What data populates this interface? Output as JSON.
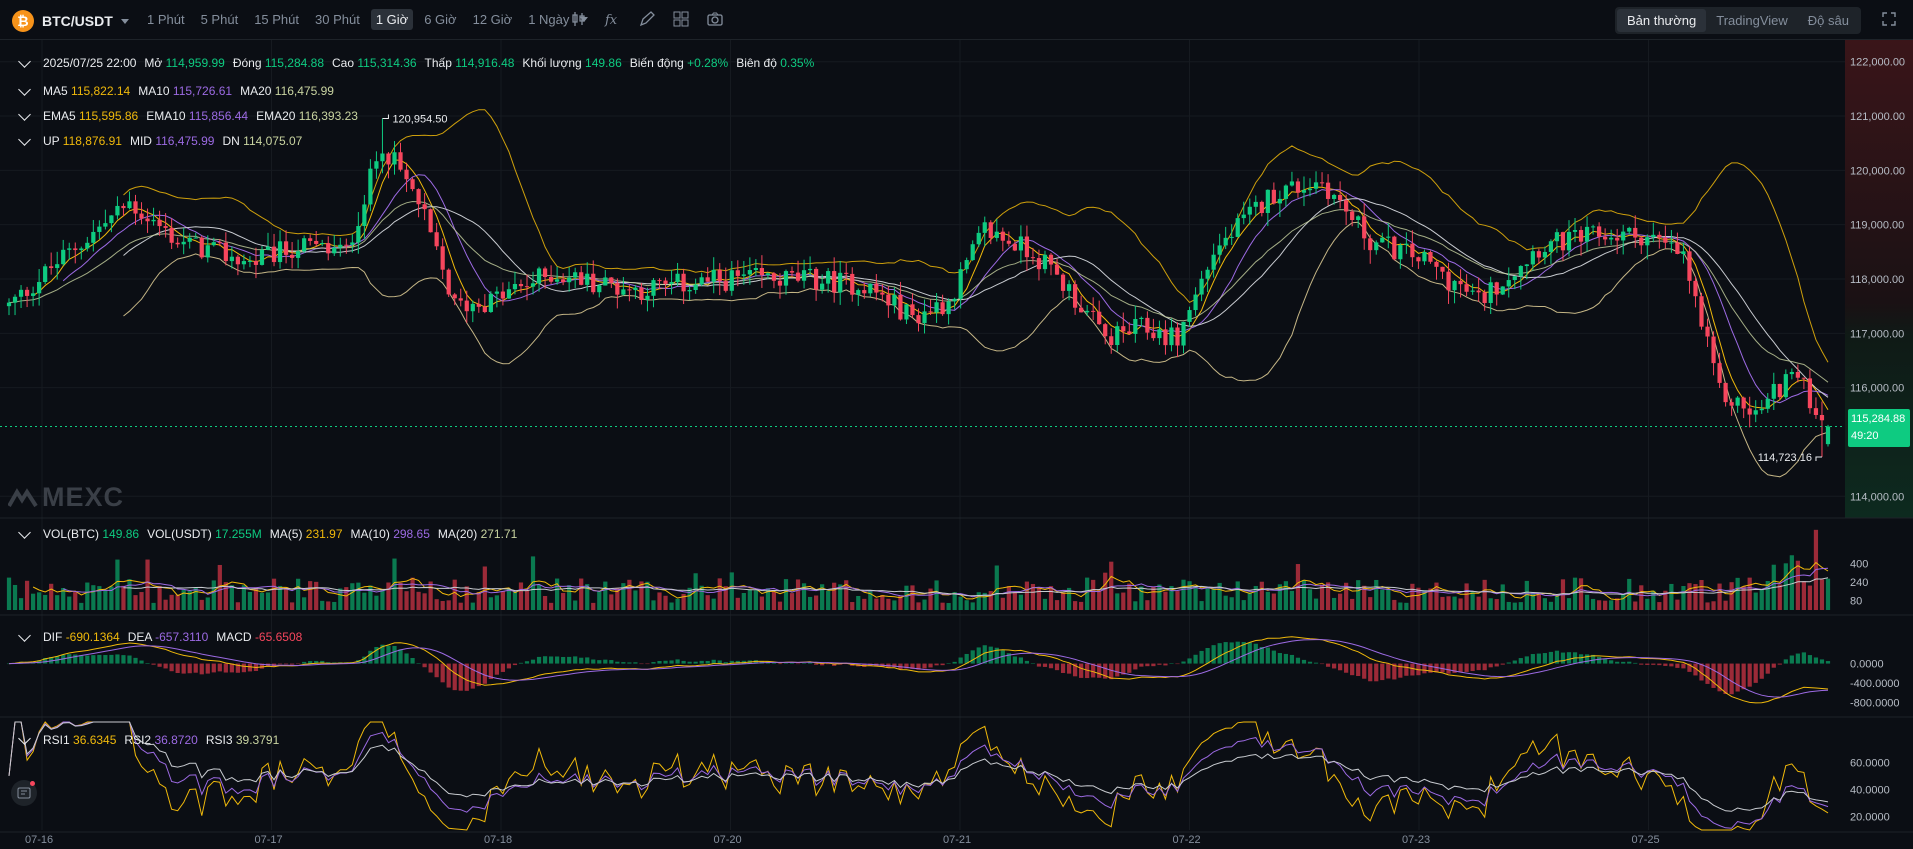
{
  "toolbar": {
    "pair": "BTC/USDT",
    "intervals": [
      "1 Phút",
      "5 Phút",
      "15 Phút",
      "30 Phút",
      "1 Giờ",
      "6 Giờ",
      "12 Giờ",
      "1 Ngày"
    ],
    "active_interval": "1 Giờ",
    "tools": [
      "candle-type-icon",
      "indicator-icon",
      "draw-icon",
      "layout-icon",
      "camera-icon"
    ],
    "views": [
      "Bản thường",
      "TradingView",
      "Độ sâu"
    ],
    "active_view": "Bản thường"
  },
  "colors": {
    "up": "#0ecb81",
    "down": "#f6465d",
    "ma5": "#f0b90b",
    "ma10": "#9c6ae3",
    "ma20": "#c8cbd0",
    "ema20": "#c9d4a1",
    "boll_up": "#f0b90b",
    "boll_mid": "#9c6ae3",
    "boll_dn": "#e6d39a"
  },
  "ohlc": {
    "date": "2025/07/25 22:00",
    "open_label": "Mở",
    "open": "114,959.99",
    "close_label": "Đóng",
    "close": "115,284.88",
    "high_label": "Cao",
    "high": "115,314.36",
    "low_label": "Thấp",
    "low": "114,916.48",
    "vol_label": "Khối lượng",
    "vol": "149.86",
    "chg_label": "Biến động",
    "chg": "+0.28%",
    "amp_label": "Biên độ",
    "amp": "0.35%"
  },
  "ma": {
    "ma5_label": "MA5",
    "ma5": "115,822.14",
    "ma10_label": "MA10",
    "ma10": "115,726.61",
    "ma20_label": "MA20",
    "ma20": "116,475.99"
  },
  "ema": {
    "ema5_label": "EMA5",
    "ema5": "115,595.86",
    "ema10_label": "EMA10",
    "ema10": "115,856.44",
    "ema20_label": "EMA20",
    "ema20": "116,393.23"
  },
  "boll": {
    "up_label": "UP",
    "up": "118,876.91",
    "mid_label": "MID",
    "mid": "116,475.99",
    "dn_label": "DN",
    "dn": "114,075.07"
  },
  "vol_legend": {
    "btc_label": "VOL(BTC)",
    "btc": "149.86",
    "usdt_label": "VOL(USDT)",
    "usdt": "17.255M",
    "ma5_label": "MA(5)",
    "ma5": "231.97",
    "ma10_label": "MA(10)",
    "ma10": "298.65",
    "ma20_label": "MA(20)",
    "ma20": "271.71"
  },
  "macd_legend": {
    "dif_label": "DIF",
    "dif": "-690.1364",
    "dea_label": "DEA",
    "dea": "-657.3110",
    "macd_label": "MACD",
    "macd": "-65.6508"
  },
  "rsi_legend": {
    "rsi1_label": "RSI1",
    "rsi1": "36.6345",
    "rsi2_label": "RSI2",
    "rsi2": "36.8720",
    "rsi3_label": "RSI3",
    "rsi3": "39.3791"
  },
  "last_price": {
    "price": "115,284.88",
    "countdown": "49:20"
  },
  "high_marker": "120,954.50",
  "low_marker": "114,723.16",
  "watermark": "MEXC",
  "chart_data": {
    "type": "candlestick",
    "interval": "1h",
    "price_axis": {
      "ticks": [
        "122,000.00",
        "121,000.00",
        "120,000.00",
        "119,000.00",
        "118,000.00",
        "117,000.00",
        "116,000.00",
        "114,000.00"
      ],
      "range": [
        113600,
        122400
      ]
    },
    "volume_axis": {
      "ticks": [
        "400",
        "240",
        "80"
      ],
      "max": 560
    },
    "macd_axis": {
      "ticks": [
        "0.0000",
        "-400.0000",
        "-800.0000"
      ],
      "range": [
        -1000,
        900
      ]
    },
    "rsi_axis": {
      "ticks": [
        "60.0000",
        "40.0000",
        "20.0000"
      ],
      "range": [
        10,
        90
      ]
    },
    "x_labels": [
      "07-16",
      "07-17",
      "07-18",
      "07-20",
      "07-21",
      "07-22",
      "07-23",
      "07-25"
    ],
    "anchors": [
      [
        0,
        117500
      ],
      [
        8,
        118300
      ],
      [
        20,
        119400
      ],
      [
        28,
        118700
      ],
      [
        40,
        118300
      ],
      [
        48,
        118600
      ],
      [
        56,
        118500
      ],
      [
        62,
        120500
      ],
      [
        68,
        119400
      ],
      [
        74,
        117500
      ],
      [
        80,
        117600
      ],
      [
        90,
        118100
      ],
      [
        104,
        117800
      ],
      [
        120,
        118000
      ],
      [
        132,
        118000
      ],
      [
        142,
        117900
      ],
      [
        150,
        117300
      ],
      [
        156,
        117600
      ],
      [
        162,
        118900
      ],
      [
        170,
        118500
      ],
      [
        176,
        117800
      ],
      [
        182,
        116900
      ],
      [
        188,
        117100
      ],
      [
        194,
        116900
      ],
      [
        200,
        118500
      ],
      [
        210,
        119600
      ],
      [
        218,
        119800
      ],
      [
        226,
        118700
      ],
      [
        234,
        118400
      ],
      [
        244,
        117600
      ],
      [
        254,
        118600
      ],
      [
        264,
        118800
      ],
      [
        272,
        118800
      ],
      [
        278,
        118400
      ],
      [
        284,
        115900
      ],
      [
        290,
        115500
      ],
      [
        296,
        116300
      ],
      [
        302,
        115300
      ]
    ]
  }
}
